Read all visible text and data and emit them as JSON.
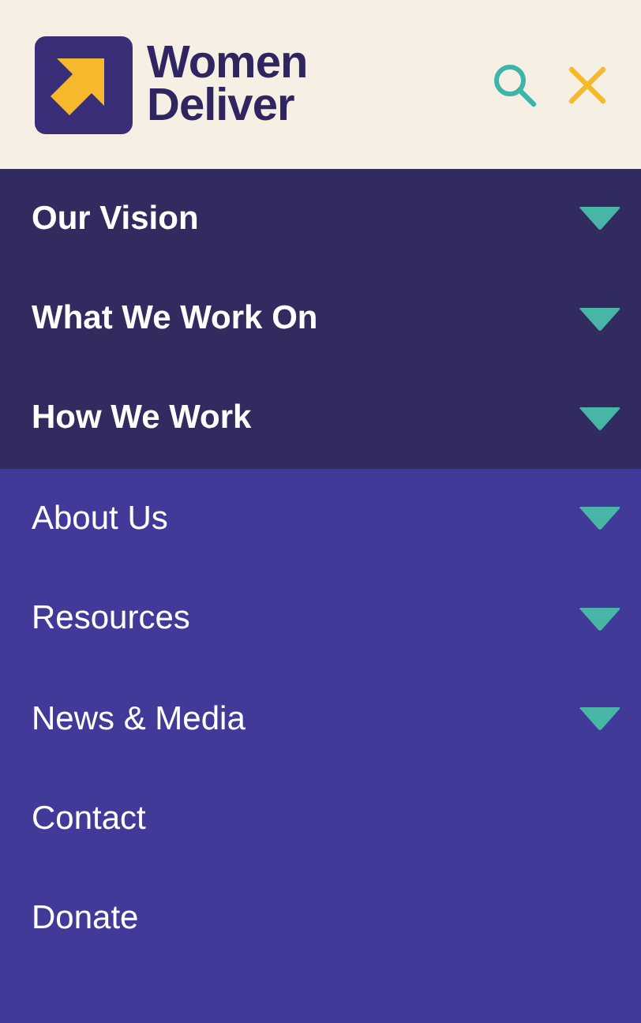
{
  "header": {
    "logo_text": "Women Deliver"
  },
  "menu": [
    {
      "label": "Our Vision",
      "kind": "primary",
      "expandable": true
    },
    {
      "label": "What We Work On",
      "kind": "primary",
      "expandable": true
    },
    {
      "label": "How We Work",
      "kind": "primary",
      "expandable": true
    },
    {
      "label": "About Us",
      "kind": "secondary",
      "expandable": true
    },
    {
      "label": "Resources",
      "kind": "secondary",
      "expandable": true
    },
    {
      "label": "News & Media",
      "kind": "secondary",
      "expandable": true
    },
    {
      "label": "Contact",
      "kind": "secondary",
      "expandable": false
    },
    {
      "label": "Donate",
      "kind": "secondary",
      "expandable": false
    }
  ]
}
